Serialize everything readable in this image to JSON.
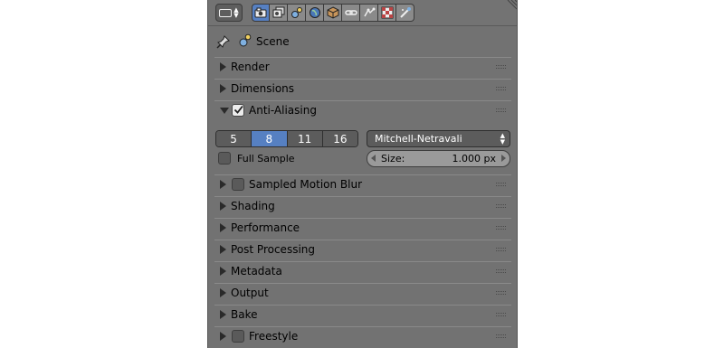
{
  "header": {
    "editor_type_icon": "properties-editor-icon",
    "tabs": [
      {
        "name": "render-tab",
        "icon": "camera-icon",
        "active": true
      },
      {
        "name": "render-layers-tab",
        "icon": "render-layers-icon",
        "active": false
      },
      {
        "name": "scene-tab",
        "icon": "scene-icon",
        "active": false
      },
      {
        "name": "world-tab",
        "icon": "world-icon",
        "active": false
      },
      {
        "name": "object-tab",
        "icon": "cube-icon",
        "active": false
      },
      {
        "name": "constraints-tab",
        "icon": "chain-link-icon",
        "active": false
      },
      {
        "name": "modifiers-tab",
        "icon": "modifiers-icon",
        "active": false
      },
      {
        "name": "texture-tab",
        "icon": "checker-texture-icon",
        "active": false
      },
      {
        "name": "particles-tab",
        "icon": "particles-icon",
        "active": false
      }
    ],
    "active_color": "#5680c2"
  },
  "context": {
    "pin_icon": "pin-icon",
    "scene_icon": "scene-icon",
    "scene_label": "Scene"
  },
  "panels": {
    "render": {
      "label": "Render",
      "expanded": false
    },
    "dimensions": {
      "label": "Dimensions",
      "expanded": false
    },
    "anti_aliasing": {
      "label": "Anti-Aliasing",
      "expanded": true,
      "enabled": true,
      "samples": [
        "5",
        "8",
        "11",
        "16"
      ],
      "selected_sample": "8",
      "filter": "Mitchell-Netravali",
      "full_sample_label": "Full Sample",
      "full_sample_checked": false,
      "size_label": "Size:",
      "size_value": "1.000 px"
    },
    "sampled_motion_blur": {
      "label": "Sampled Motion Blur",
      "expanded": false,
      "enabled": false
    },
    "shading": {
      "label": "Shading",
      "expanded": false
    },
    "performance": {
      "label": "Performance",
      "expanded": false
    },
    "post_processing": {
      "label": "Post Processing",
      "expanded": false
    },
    "metadata": {
      "label": "Metadata",
      "expanded": false
    },
    "output": {
      "label": "Output",
      "expanded": false
    },
    "bake": {
      "label": "Bake",
      "expanded": false
    },
    "freestyle": {
      "label": "Freestyle",
      "expanded": false,
      "enabled": false
    }
  },
  "colors": {
    "panel_bg": "#727272",
    "widget_bg": "#5c5c5c",
    "accent": "#5680c2"
  }
}
